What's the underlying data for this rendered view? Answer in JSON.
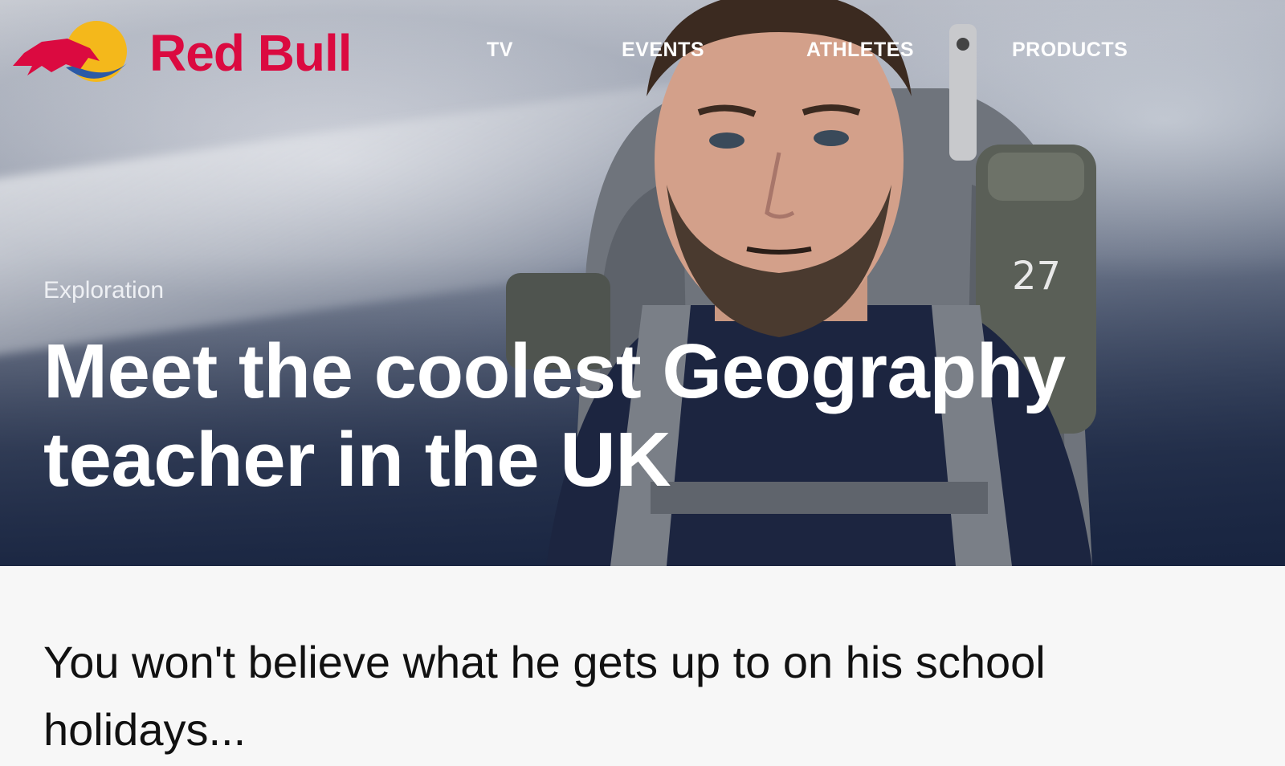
{
  "brand": {
    "name": "Red Bull",
    "logo_icon": "red-bull-logo-icon",
    "color": "#db0a40"
  },
  "nav": {
    "items": [
      {
        "label": "TV"
      },
      {
        "label": "EVENTS"
      },
      {
        "label": "ATHLETES"
      },
      {
        "label": "PRODUCTS"
      }
    ]
  },
  "hero": {
    "category": "Exploration",
    "title": "Meet the coolest Geography teacher in the UK"
  },
  "article": {
    "standfirst": "You won't believe what he gets up to on his school holidays..."
  }
}
